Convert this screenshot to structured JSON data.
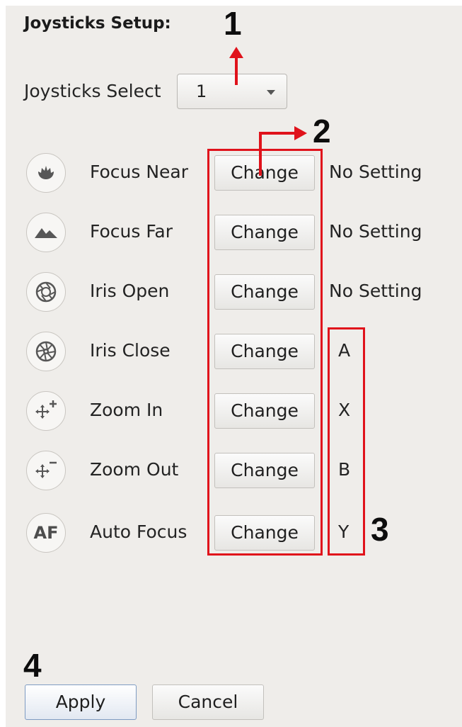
{
  "setup": {
    "title": "Joysticks Setup:",
    "select_label": "Joysticks Select",
    "select_value": "1"
  },
  "rows": [
    {
      "icon": "flower-icon",
      "label": "Focus Near",
      "button": "Change",
      "setting": "No Setting"
    },
    {
      "icon": "mountain-icon",
      "label": "Focus Far",
      "button": "Change",
      "setting": "No Setting"
    },
    {
      "icon": "aperture-open-icon",
      "label": "Iris Open",
      "button": "Change",
      "setting": "No Setting"
    },
    {
      "icon": "aperture-close-icon",
      "label": "Iris Close",
      "button": "Change",
      "setting": "A"
    },
    {
      "icon": "zoom-in-icon",
      "label": "Zoom In",
      "button": "Change",
      "setting": "X"
    },
    {
      "icon": "zoom-out-icon",
      "label": "Zoom Out",
      "button": "Change",
      "setting": "B"
    },
    {
      "icon": "af-icon",
      "icon_text": "AF",
      "label": "Auto Focus",
      "button": "Change",
      "setting": "Y"
    }
  ],
  "actions": {
    "apply": "Apply",
    "cancel": "Cancel"
  },
  "callouts": [
    "1",
    "2",
    "3",
    "4"
  ],
  "colors": {
    "panel_bg": "#efedea",
    "callout_red": "#e0121b"
  }
}
